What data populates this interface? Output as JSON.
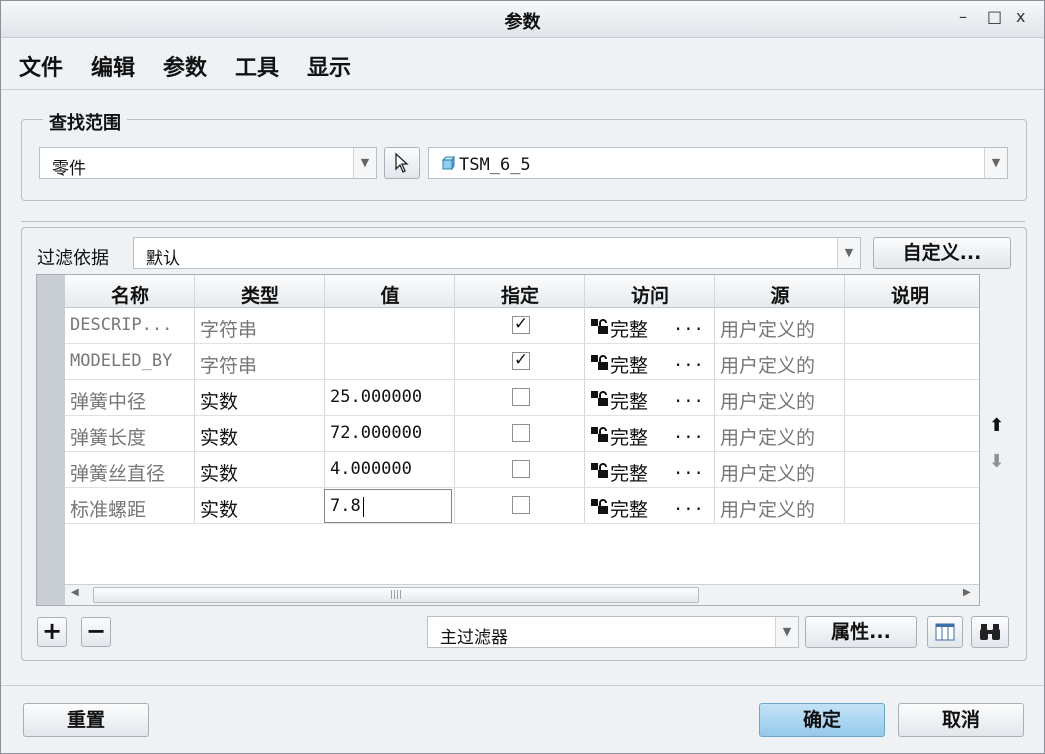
{
  "window": {
    "title": "参数",
    "minimize": "–",
    "maximize": "□",
    "close": "x"
  },
  "menu": [
    "文件",
    "编辑",
    "参数",
    "工具",
    "显示"
  ],
  "lookin": {
    "label": "查找范围",
    "scope_value": "零件",
    "model_value": "TSM_6_5"
  },
  "filter": {
    "label": "过滤依据",
    "value": "默认",
    "customize_label": "自定义..."
  },
  "table": {
    "columns": [
      "名称",
      "类型",
      "值",
      "指定",
      "访问",
      "源",
      "说明"
    ],
    "rows": [
      {
        "name": "DESCRIP...",
        "type": "字符串",
        "value": "",
        "designate": true,
        "access": "完整",
        "more": "...",
        "source": "用户定义的",
        "desc": ""
      },
      {
        "name": "MODELED_BY",
        "type": "字符串",
        "value": "",
        "designate": true,
        "access": "完整",
        "more": "...",
        "source": "用户定义的",
        "desc": ""
      },
      {
        "name": "弹簧中径",
        "type": "实数",
        "value": "25.000000",
        "designate": false,
        "access": "完整",
        "more": "...",
        "source": "用户定义的",
        "desc": ""
      },
      {
        "name": "弹簧长度",
        "type": "实数",
        "value": "72.000000",
        "designate": false,
        "access": "完整",
        "more": "...",
        "source": "用户定义的",
        "desc": ""
      },
      {
        "name": "弹簧丝直径",
        "type": "实数",
        "value": "4.000000",
        "designate": false,
        "access": "完整",
        "more": "...",
        "source": "用户定义的",
        "desc": ""
      },
      {
        "name": "标准螺距",
        "type": "实数",
        "value": "7.8",
        "designate": false,
        "access": "完整",
        "more": "...",
        "source": "用户定义的",
        "desc": ""
      }
    ]
  },
  "bottom_toolbar": {
    "add": "+",
    "remove": "−",
    "main_filter_value": "主过滤器",
    "properties_label": "属性..."
  },
  "footer": {
    "reset": "重置",
    "ok": "确定",
    "cancel": "取消"
  },
  "colors": {
    "ok_button": "#a9d3ef",
    "row_header": "#c8ced3"
  }
}
